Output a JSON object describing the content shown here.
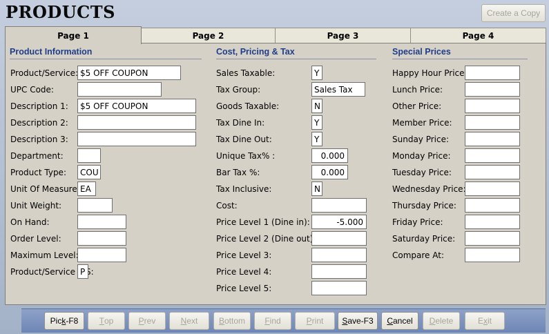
{
  "window": {
    "title": "PRODUCTS",
    "copy_button": "Create a Copy"
  },
  "tabs": [
    "Page 1",
    "Page 2",
    "Page 3",
    "Page 4"
  ],
  "sections": {
    "product_info": "Product Information",
    "cost_pricing": "Cost, Pricing & Tax",
    "special_prices": "Special Prices"
  },
  "product_info": [
    {
      "label": "Product/Service:",
      "value": "$5 OFF COUPON"
    },
    {
      "label": "UPC Code:",
      "value": ""
    },
    {
      "label": "Description 1:",
      "value": "$5 OFF COUPON"
    },
    {
      "label": "Description 2:",
      "value": ""
    },
    {
      "label": "Description 3:",
      "value": ""
    },
    {
      "label": "Department:",
      "value": ""
    },
    {
      "label": "Product Type:",
      "value": "COU"
    },
    {
      "label": "Unit Of Measure:",
      "value": "EA"
    },
    {
      "label": "Unit Weight:",
      "value": ""
    },
    {
      "label": "On Hand:",
      "value": ""
    },
    {
      "label": "Order Level:",
      "value": ""
    },
    {
      "label": "Maximum Level:",
      "value": ""
    },
    {
      "label": "Product/Service P/S:",
      "value": "P"
    }
  ],
  "cost_pricing": [
    {
      "label": "Sales Taxable:",
      "value": "Y"
    },
    {
      "label": "Tax Group:",
      "value": "Sales Tax"
    },
    {
      "label": "Goods Taxable:",
      "value": "N"
    },
    {
      "label": "Tax Dine In:",
      "value": "Y"
    },
    {
      "label": "Tax Dine Out:",
      "value": "Y"
    },
    {
      "label": "Unique Tax% :",
      "value": "0.000"
    },
    {
      "label": "Bar Tax %:",
      "value": "0.000"
    },
    {
      "label": "Tax Inclusive:",
      "value": "N"
    },
    {
      "label": "Cost:",
      "value": ""
    },
    {
      "label": "Price Level 1 (Dine in):",
      "value": "-5.000"
    },
    {
      "label": "Price Level 2 (Dine out):",
      "value": ""
    },
    {
      "label": "Price Level 3:",
      "value": ""
    },
    {
      "label": "Price Level 4:",
      "value": ""
    },
    {
      "label": "Price Level 5:",
      "value": ""
    }
  ],
  "special_prices": [
    {
      "label": "Happy Hour Price:",
      "value": ""
    },
    {
      "label": "Lunch Price:",
      "value": ""
    },
    {
      "label": "Other Price:",
      "value": ""
    },
    {
      "label": "Member Price:",
      "value": ""
    },
    {
      "label": "Sunday Price:",
      "value": ""
    },
    {
      "label": "Monday Price:",
      "value": ""
    },
    {
      "label": "Tuesday Price:",
      "value": ""
    },
    {
      "label": "Wednesday Price:",
      "value": ""
    },
    {
      "label": "Thursday Price:",
      "value": ""
    },
    {
      "label": "Friday Price:",
      "value": ""
    },
    {
      "label": "Saturday Price:",
      "value": ""
    },
    {
      "label": "Compare At:",
      "value": ""
    }
  ],
  "toolbar": [
    {
      "label": "Pick-F8",
      "ul": "k",
      "enabled": true
    },
    {
      "label": "Top",
      "ul": "T",
      "enabled": false
    },
    {
      "label": "Prev",
      "ul": "P",
      "enabled": false
    },
    {
      "label": "Next",
      "ul": "N",
      "enabled": false
    },
    {
      "label": "Bottom",
      "ul": "B",
      "enabled": false
    },
    {
      "label": "Find",
      "ul": "F",
      "enabled": false
    },
    {
      "label": "Print",
      "ul": "P",
      "enabled": false
    },
    {
      "label": "Save-F3",
      "ul": "S",
      "enabled": true
    },
    {
      "label": "Cancel",
      "ul": "C",
      "enabled": true
    },
    {
      "label": "Delete",
      "ul": "D",
      "enabled": false
    },
    {
      "label": "Exit",
      "ul": "x",
      "enabled": false
    }
  ]
}
